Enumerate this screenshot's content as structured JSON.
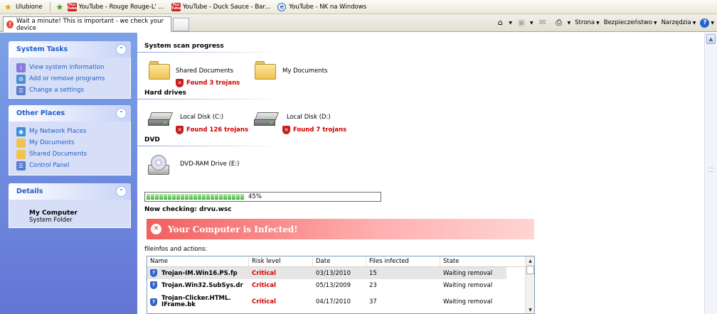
{
  "favorites": {
    "label": "Ulubione",
    "items": [
      {
        "label": "YouTube - Rouge Rouge-L' ...",
        "icon": "youtube-icon"
      },
      {
        "label": "YouTube - Duck Sauce - Bar...",
        "icon": "youtube-icon"
      },
      {
        "label": "YouTube - NK na Windows",
        "icon": "ie-page-icon"
      }
    ]
  },
  "tab": {
    "title": "Wait a minute! This is important - we check your device"
  },
  "toolbar": {
    "page": "Strona",
    "security": "Bezpieczeństwo",
    "tools": "Narzędzia"
  },
  "left_panel": {
    "system_tasks": {
      "title": "System Tasks",
      "items": [
        {
          "label": "View system information"
        },
        {
          "label": "Add or remove programs"
        },
        {
          "label": "Change a settings"
        }
      ]
    },
    "other_places": {
      "title": "Other Places",
      "items": [
        {
          "label": "My Network Places"
        },
        {
          "label": "My Documents"
        },
        {
          "label": "Shared Documents"
        },
        {
          "label": "Control Panel"
        }
      ]
    },
    "details": {
      "title": "Details",
      "name": "My Computer",
      "sub": "System Folder"
    }
  },
  "scan": {
    "title": "System scan progress",
    "folders": [
      {
        "label": "Shared Documents",
        "found": "Found 3 trojans"
      },
      {
        "label": "My Documents",
        "found": ""
      }
    ],
    "hard_drives_title": "Hard drives",
    "drives": [
      {
        "label": "Local Disk (C:)",
        "found": "Found 126 trojans"
      },
      {
        "label": "Local Disk (D:)",
        "found": "Found 7 trojans"
      }
    ],
    "dvd_title": "DVD",
    "dvd": {
      "label": "DVD-RAM Drive (E:)"
    },
    "progress": {
      "percent": 45,
      "label": "45%"
    },
    "now_checking": "Now checking: drvu.wsc",
    "infected_banner": "Your Computer is Infected!",
    "fileinfos_label": "fileinfos and actions:"
  },
  "table": {
    "columns": [
      "Name",
      "Risk level",
      "Date",
      "Files infected",
      "State"
    ],
    "rows": [
      {
        "name": "Trojan-IM.Win16.PS.fp",
        "risk": "Critical",
        "date": "03/13/2010",
        "files": "15",
        "state": "Waiting removal"
      },
      {
        "name": "Trojan.Win32.SubSys.dr",
        "risk": "Critical",
        "date": "05/13/2009",
        "files": "23",
        "state": "Waiting removal"
      },
      {
        "name_line1": "Trojan-Clicker.HTML.",
        "name_line2": "IFrame.bk",
        "risk": "Critical",
        "date": "04/17/2010",
        "files": "37",
        "state": "Waiting removal"
      }
    ]
  },
  "colors": {
    "accent": "#215dc6",
    "danger": "#d10000",
    "panel_bg": "#6f8de0"
  }
}
